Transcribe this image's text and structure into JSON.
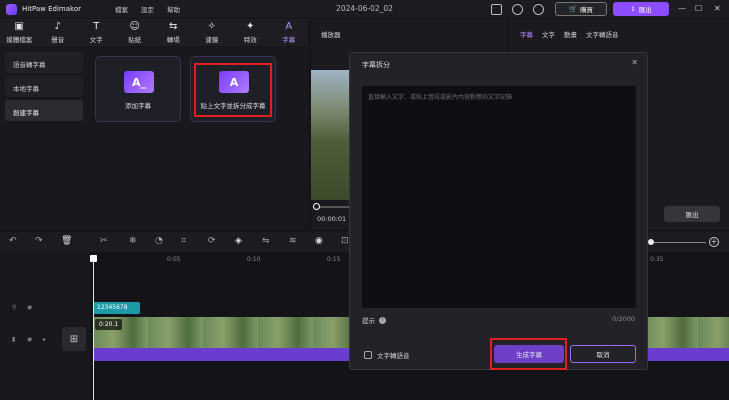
{
  "app": {
    "name": "HitPaw Edimakor",
    "document_title": "2024-06-02_02"
  },
  "menu": [
    "檔案",
    "設定",
    "幫助"
  ],
  "titlebar": {
    "buy_label": "購買",
    "export_label": "匯出"
  },
  "toolbar": [
    {
      "label": "媒體檔案",
      "icon": "media-icon"
    },
    {
      "label": "聲音",
      "icon": "music-note-icon"
    },
    {
      "label": "文字",
      "icon": "text-icon"
    },
    {
      "label": "貼紙",
      "icon": "sticker-icon"
    },
    {
      "label": "轉場",
      "icon": "transition-icon"
    },
    {
      "label": "濾鏡",
      "icon": "filter-icon"
    },
    {
      "label": "特效",
      "icon": "effect-icon"
    },
    {
      "label": "字幕",
      "icon": "subtitle-icon",
      "active": true
    }
  ],
  "subnav": [
    "語音轉字幕",
    "本地字幕",
    "創建字幕"
  ],
  "cards": [
    {
      "label": "添加字幕",
      "icon_text": "A_"
    },
    {
      "label": "貼上文字並拆分成字幕",
      "icon_text": "A"
    }
  ],
  "player": {
    "title": "播放器",
    "time": "00:00:01"
  },
  "right_panel": {
    "tabs": [
      "字幕",
      "文字",
      "動畫",
      "文字轉語音"
    ],
    "export_label": "匯出"
  },
  "timeline": {
    "ruler": [
      "0:05",
      "0:10",
      "0:15",
      "0:35"
    ],
    "subtitle_clip": "12345678",
    "video_clip": "0:20.1"
  },
  "dialog": {
    "title": "字幕拆分",
    "placeholder": "直接輸入文字、或貼上音訊或影片內容對應的文字記錄",
    "hint": "提示",
    "count": "0/2000",
    "checkbox_label": "文字轉語音",
    "generate_label": "生成字幕",
    "cancel_label": "取消"
  },
  "colors": {
    "accent": "#8b4dff",
    "highlight": "#e02020",
    "subtitle_clip": "#1e9aa6",
    "audio_bar": "#6a3ccf"
  }
}
